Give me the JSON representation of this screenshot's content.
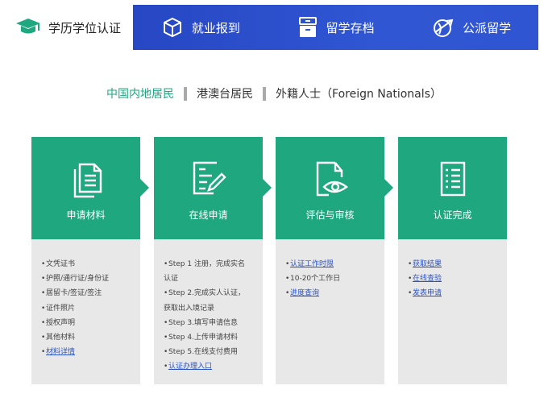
{
  "topnav": {
    "active_tab": {
      "label": "学历学位认证",
      "icon": "graduation-cap-icon"
    },
    "items": [
      {
        "label": "就业报到",
        "icon": "network-cube-icon"
      },
      {
        "label": "留学存档",
        "icon": "archive-icon"
      },
      {
        "label": "公派留学",
        "icon": "plane-globe-icon"
      }
    ]
  },
  "region_tabs": [
    {
      "label": "中国内地居民",
      "active": true
    },
    {
      "label": "港澳台居民",
      "active": false
    },
    {
      "label": "外籍人士（Foreign Nationals）",
      "active": false
    }
  ],
  "colors": {
    "accent": "#1fa77f",
    "nav_blue": "#2f55d2",
    "panel_gray": "#e8e8e8",
    "link": "#2b55c7"
  },
  "steps": [
    {
      "title": "申请材料",
      "icon": "documents-icon",
      "items": [
        {
          "text": "文凭证书",
          "link": false
        },
        {
          "text": "护照/通行证/身份证",
          "link": false
        },
        {
          "text": "居留卡/签证/签注",
          "link": false
        },
        {
          "text": "证件照片",
          "link": false
        },
        {
          "text": "授权声明",
          "link": false
        },
        {
          "text": "其他材料",
          "link": false
        },
        {
          "text": "材料详情",
          "link": true
        }
      ]
    },
    {
      "title": "在线申请",
      "icon": "form-edit-icon",
      "items": [
        {
          "text": "Step 1 注册，完成实名",
          "link": false
        },
        {
          "text": "认证",
          "link": false,
          "cont": true
        },
        {
          "text": "Step 2.完成实人认证，",
          "link": false
        },
        {
          "text": "获取出入境记录",
          "link": false,
          "cont": true
        },
        {
          "text": "Step 3.填写申请信息",
          "link": false
        },
        {
          "text": "Step 4.上传申请材料",
          "link": false
        },
        {
          "text": "Step 5.在线支付费用",
          "link": false
        },
        {
          "text": "认证办理入口",
          "link": true
        }
      ]
    },
    {
      "title": "评估与审核",
      "icon": "document-eye-icon",
      "items": [
        {
          "text": "认证工作时限",
          "link": true
        },
        {
          "text": "10-20个工作日",
          "link": false
        },
        {
          "text": "进度查询",
          "link": true
        }
      ]
    },
    {
      "title": "认证完成",
      "icon": "checklist-icon",
      "items": [
        {
          "text": "获取结果",
          "link": true
        },
        {
          "text": "在线查验",
          "link": true
        },
        {
          "text": "发表申请",
          "link": true
        }
      ]
    }
  ]
}
